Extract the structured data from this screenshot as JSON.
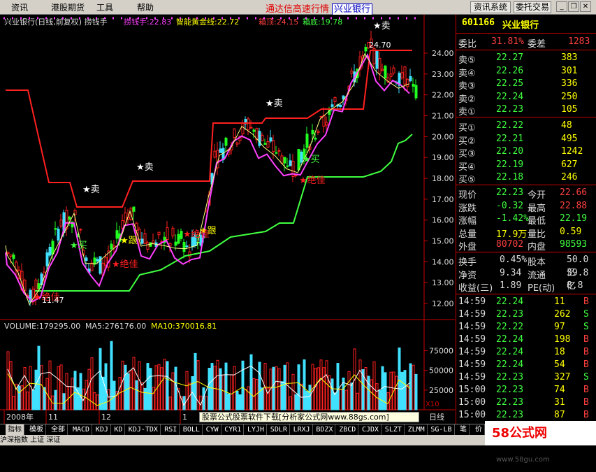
{
  "menu": [
    "资讯",
    "港股期货",
    "工具",
    "帮助"
  ],
  "title": "通达信高速行情",
  "title_stock": "兴业银行",
  "buttons": {
    "info": "资讯系统",
    "trade": "委托交易"
  },
  "chart": {
    "header": "兴业银行(日线,前复权) 捞钱手",
    "lqs": "捞钱手:22.83",
    "gold": "智能黄金线:22.72",
    "top": "箱顶:24.15",
    "bottom": "箱底:19.78",
    "y_ticks": [
      "24.00",
      "23.00",
      "22.00",
      "21.00",
      "20.00",
      "19.00",
      "18.00",
      "17.00",
      "16.00",
      "15.00",
      "14.00",
      "13.00",
      "12.00"
    ],
    "vol_ticks": [
      "75000",
      "50000",
      "25000"
    ],
    "vol_unit": "X10",
    "price_max_label": "24.70",
    "price_min_label": "11.47",
    "signals": {
      "buy": "买",
      "sell": "卖",
      "jue": "绝佳",
      "gen": "跟"
    },
    "vol_header": "VOLUME:179295.00",
    "ma5": "MA5:276176.00",
    "ma10": "MA10:370016.81",
    "x_labels": [
      "2008年",
      "11",
      "12",
      "1"
    ],
    "period": "日线"
  },
  "chart_data": {
    "type": "candlestick",
    "title": "兴业银行(日线,前复权)",
    "ylim": [
      11,
      24.9
    ],
    "box_top": 24.15,
    "box_bottom": 19.78,
    "high": 24.7,
    "low": 11.47,
    "last": 22.23,
    "volume_last": 179295,
    "ma5": 276176,
    "ma10": 370016.81
  },
  "quote": {
    "code": "601166",
    "name": "兴业银行",
    "wb_label": "委比",
    "wb": "31.81%",
    "wc_label": "委差",
    "wc": "1283",
    "sells": [
      {
        "l": "卖⑤",
        "p": "22.27",
        "v": "383"
      },
      {
        "l": "卖④",
        "p": "22.26",
        "v": "301"
      },
      {
        "l": "卖③",
        "p": "22.25",
        "v": "336"
      },
      {
        "l": "卖②",
        "p": "22.24",
        "v": "250"
      },
      {
        "l": "卖①",
        "p": "22.23",
        "v": "105"
      }
    ],
    "buys": [
      {
        "l": "买①",
        "p": "22.22",
        "v": "48"
      },
      {
        "l": "买②",
        "p": "22.21",
        "v": "495"
      },
      {
        "l": "买③",
        "p": "22.20",
        "v": "1242"
      },
      {
        "l": "买④",
        "p": "22.19",
        "v": "627"
      },
      {
        "l": "买⑤",
        "p": "22.18",
        "v": "246"
      }
    ],
    "stats": [
      [
        "现价",
        "22.23",
        "今开",
        "22.66"
      ],
      [
        "涨跌",
        "-0.32",
        "最高",
        "22.88"
      ],
      [
        "涨幅",
        "-1.42%",
        "最低",
        "22.19"
      ],
      [
        "总量",
        "17.9万",
        "量比",
        "0.59"
      ],
      [
        "外盘",
        "80702",
        "内盘",
        "98593"
      ]
    ],
    "stats2": [
      [
        "换手",
        "0.45%",
        "股本",
        "50.0亿"
      ],
      [
        "净资",
        "9.34",
        "流通",
        "39.8亿"
      ],
      [
        "收益(三)",
        "1.89",
        "PE(动)",
        "8.8"
      ]
    ],
    "ticks": [
      [
        "14:59",
        "22.24",
        "11",
        "B"
      ],
      [
        "14:59",
        "22.23",
        "262",
        "S"
      ],
      [
        "14:59",
        "22.22",
        "97",
        "S"
      ],
      [
        "14:59",
        "22.24",
        "198",
        "B"
      ],
      [
        "14:59",
        "22.24",
        "18",
        "B"
      ],
      [
        "14:59",
        "22.24",
        "54",
        "B"
      ],
      [
        "14:59",
        "22.23",
        "327",
        "S"
      ],
      [
        "15:00",
        "22.23",
        "74",
        "B"
      ],
      [
        "15:00",
        "22.23",
        "31",
        "B"
      ],
      [
        "15:00",
        "22.23",
        "87",
        "B"
      ]
    ]
  },
  "tabs": [
    "指标",
    "模板",
    "全部",
    "MACD",
    "KDJ",
    "KD",
    "KDJ-TDX",
    "RSI",
    "BOLL",
    "CYW",
    "CYR1",
    "LYJH",
    "SDLR",
    "LRXJ",
    "BDZX",
    "ZBCD",
    "CJDX",
    "SLZT",
    "ZLMM",
    "SG-LB"
  ],
  "quote_tabs": [
    "笔",
    "价"
  ],
  "ad": "股票公式股票软件下载[分析家公式网www.88gs.com]",
  "watermark": "58公式网",
  "watermark_url": "www.58gu.com",
  "status": "沪深指数 上证 深证"
}
